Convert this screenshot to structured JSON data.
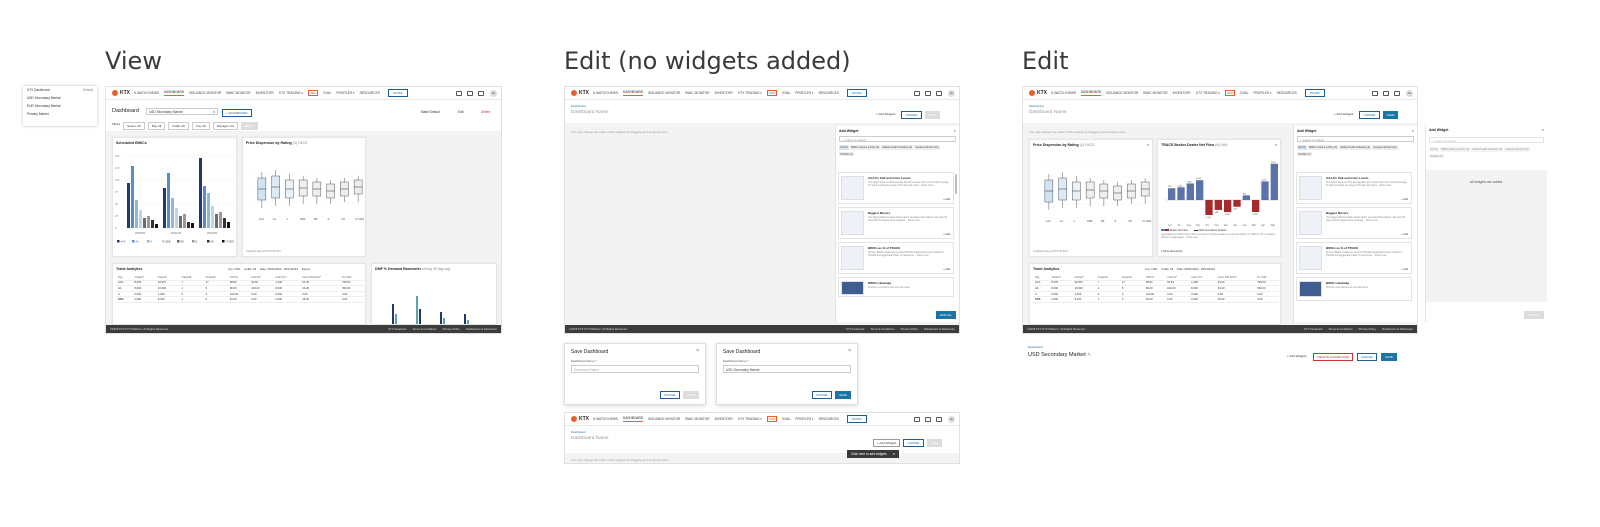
{
  "sections": {
    "view": "View",
    "edit_empty": "Edit (no widgets added)",
    "edit": "Edit"
  },
  "colors": {
    "brand": "#e8612c",
    "primary": "#1a74a6",
    "navy": "#1f3b6e",
    "teal": "#5ba3a8",
    "danger": "#c33333"
  },
  "nav": {
    "logo": "KTX",
    "items": [
      "K-WATCH NEWS",
      "DASHBOARD",
      "ISSUANCE MONITOR",
      "BWIC MONITOR",
      "INVENTORY",
      "KTX TRADING ▾",
      "NEW",
      "EVAL",
      "PROFILES ▾",
      "RESOURCES"
    ],
    "invite": "INVITE",
    "avatar": "AH"
  },
  "footer": {
    "copyright": "©2025 KTX KTX Platform. All Rights Reserved.",
    "links": [
      "KTX Notebook",
      "Terms & Conditions",
      "Privacy Policy",
      "Disclaimers & Disclosure"
    ]
  },
  "view": {
    "dropdown": {
      "header": "KTX Dashboard",
      "header_tag": "Default",
      "items": [
        "USD Secondary Market",
        "EUR Secondary Market",
        "Primary Market"
      ]
    },
    "title": "Dashboard",
    "select": "USD Secondary Market",
    "new_dashboard": "+ DASHBOARD",
    "make_default": "Make Default",
    "edit": "Edit",
    "delete": "Delete",
    "filters": [
      "Filters",
      "Sector: All",
      "Rtg: All",
      "Collat: All",
      "Cny: All",
      "Manager: All"
    ],
    "apply": "APPLY",
    "scheduled_title": "Scheduled BWICs",
    "scheduled_dates": [
      "05/20/25",
      "05/21/25",
      "05/22/25"
    ],
    "scheduled_legend": [
      "AAA",
      "AA",
      "A",
      "BBB",
      "BB",
      "B",
      "NR",
      "OTHER"
    ],
    "y_ticks": [
      "150",
      "125",
      "100",
      "75",
      "50",
      "25",
      "0"
    ],
    "price_title": "Price Dispersion by Rating",
    "price_sub": "(3) FACE",
    "price_cats": [
      "AAA",
      "AA",
      "A",
      "BBB",
      "BB",
      "B",
      "NR",
      "OTHER"
    ],
    "price_updated": "Updated daily at 5:00 PM EST",
    "trade_title": "Trade Analytics",
    "trade_filters": [
      "Ccy: USD",
      "Collat: All",
      "Date: 05/21/2024 - 05/21/2024"
    ],
    "export": "Export",
    "trade_cols": [
      "Rtg",
      "Traded*",
      "Posted*",
      "Traded#",
      "Posted#",
      "DNT%",
      "Color%*",
      "Color Px*",
      "Color DM Sprd*",
      "Px Talk*"
    ],
    "trade_rows": [
      [
        "AAA",
        "8,678",
        "32,507",
        "7",
        "17",
        "58.82",
        "92.84",
        "1,290",
        "64.00",
        "799.00",
        "49.00"
      ],
      [
        "AA",
        "8,000",
        "10,600",
        "1",
        "5",
        "80.00",
        "100.00",
        "8,000",
        "64.00",
        "530.00",
        "0.00"
      ],
      [
        "A",
        "0.000",
        "1,000",
        "0",
        "3",
        "100.00",
        "0.00",
        "0.000",
        "0.00",
        "0.00",
        "0.00"
      ],
      [
        "BBB",
        "2,000",
        "8,100",
        "1",
        "6",
        "81.00",
        "0.00",
        "2,000",
        "45.00",
        "0.00",
        "0.00"
      ]
    ],
    "dmf_title": "DMF % Demand Barometer",
    "dmf_sub": "rolling 30 day avg"
  },
  "edit_empty": {
    "breadcrumb": "Dashboard",
    "name_placeholder": "Dashboard Name",
    "add_widgets": "+ Add Widgets",
    "cancel": "CANCEL",
    "save": "SAVE",
    "hint": "You may change the order of the widgets by dragging and dropping them.",
    "panel": {
      "title": "Add Widget",
      "search": "Search for widget",
      "chips": [
        "All (21)",
        "BWICs Volume & Price (9)",
        "Market Health Indicators (6)",
        "Issuance Monitor (10)",
        "Portfolio (2)"
      ],
      "widgets": [
        {
          "name": "AAA Px Talk and Color Levels",
          "desc": "This graph plots monthly average Bid price levels color and monthly average Px talk (including the range of Px talk and color)... Show more",
          "add": "+ Add"
        },
        {
          "name": "Biggest Movers",
          "desc": "The biggest Movers table shows which securities that traded in the past 30 days had the largest price changes... Show more",
          "add": "+ Add"
        },
        {
          "name": "BWICs as % of TRACE",
          "desc": "All CLO BWIC treaties as reported TRACE participations are included in TRACE and aggregated data. To determine... Show more",
          "add": "+ Add"
        },
        {
          "name": "BWICs Heatmap",
          "desc": "Find the most bwics and your bid prices",
          "add": "+ Add"
        }
      ],
      "add_all": "ADD ALL"
    },
    "save_modal_empty": {
      "title": "Save Dashboard",
      "label": "Dashboard Name *",
      "placeholder": "Dashboard Name",
      "cancel": "CANCEL",
      "save": "SAVE"
    },
    "save_modal_filled": {
      "title": "Save Dashboard",
      "label": "Dashboard Name *",
      "value": "USD Secondary Market",
      "cancel": "CANCEL",
      "save": "SAVE"
    },
    "toast": "Click here to add widgets"
  },
  "edit": {
    "breadcrumb": "Dashboard",
    "name_placeholder": "Dashboard Name",
    "add_widgets": "+ Add Widgets",
    "cancel": "CANCEL",
    "save": "SAVE",
    "hint": "You may change the order of the widgets by dragging and dropping them.",
    "price_title": "Price Dispersion by Rating",
    "price_sub": "(3) FACE",
    "price_cats": [
      "AAA",
      "AA",
      "A",
      "BBB",
      "BB",
      "B",
      "NR",
      "OTHER"
    ],
    "price_updated": "Updated daily at 5:00 PM EST",
    "trace_title": "TRACE Broker-Dealer Net Flow",
    "trace_sub": "(M) MM",
    "trace_months": [
      "Jun",
      "Jul",
      "Aug",
      "Sep",
      "Oct",
      "Nov",
      "Dec",
      "Jan",
      "Feb",
      "Mar",
      "Apr",
      "May"
    ],
    "trace_values": [
      980,
      1060,
      1380,
      1650,
      -1250,
      -830,
      -1010,
      -560,
      390,
      -1000,
      1550,
      3020
    ],
    "trace_legend": [
      "Dealer Net Flow",
      "2025 Cumulative Position"
    ],
    "trace_note": "Aggregated CLO/CDO flows to/from customers of broker-dealers as reported publicly to TRACE. The cumulative balance of aggregated... Show more",
    "show_description": "Show description",
    "trade_title": "Trade Analytics",
    "trade_filters": [
      "Ccy: USD",
      "Collat: All",
      "Date: 05/21/2024 - 05/21/2024"
    ],
    "panel_title": "Add Widget",
    "panel2_empty": "All widgets are added.",
    "bottom": {
      "breadcrumb": "Dashboard",
      "name": "USD Secondary Market",
      "add_widgets": "+ Add Widgets",
      "delete": "DELETE DASHBOARD",
      "cancel": "CANCEL",
      "save": "SAVE"
    }
  }
}
